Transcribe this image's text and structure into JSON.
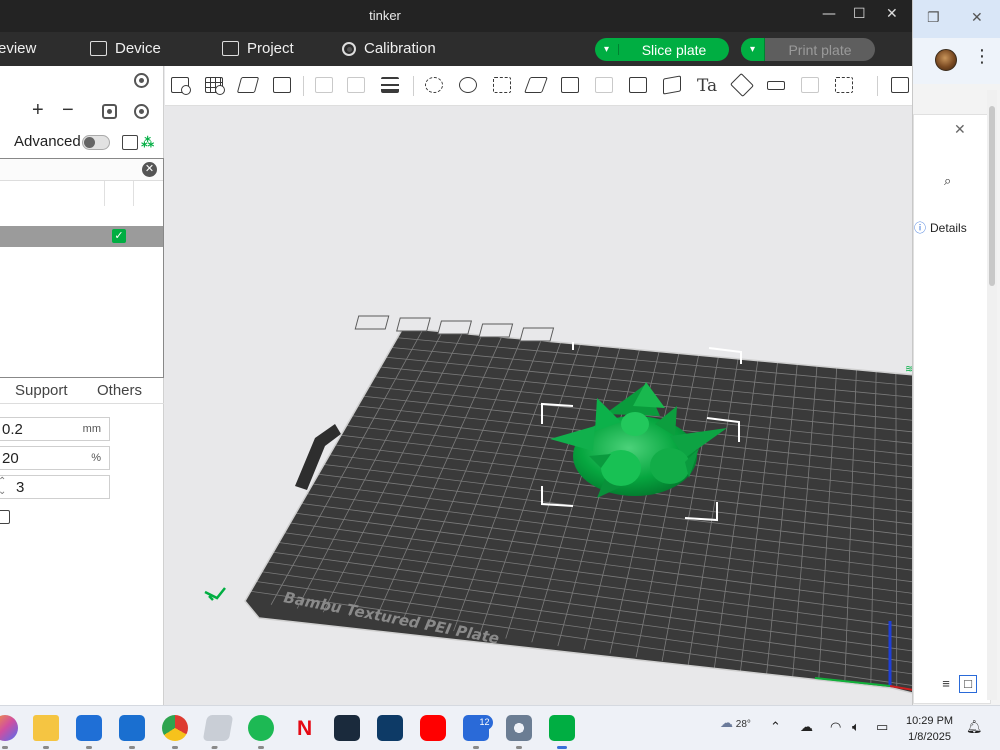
{
  "window": {
    "title": "tinker"
  },
  "window_controls": {
    "minimize": "—",
    "maximize": "☐",
    "close": "✕"
  },
  "menubar": {
    "preview": "eview",
    "device": "Device",
    "project": "Project",
    "calibration": "Calibration",
    "slice": "Slice plate",
    "print": "Print plate"
  },
  "left_panel": {
    "advanced_label": "Advanced",
    "advanced_on": false,
    "tabs": [
      "Support",
      "Others"
    ],
    "fields": [
      {
        "value": "0.2",
        "unit": "mm"
      },
      {
        "value": "20",
        "unit": "%"
      },
      {
        "value": "3",
        "unit": ""
      }
    ]
  },
  "toolbar": {
    "text_tool_glyph": "Ta"
  },
  "viewport": {
    "plate_label": "Bambu Textured PEI Plate",
    "plate_color": "#3a3a3a",
    "model_color": "#00ae42",
    "accent_color": "#00ae42"
  },
  "background_window": {
    "details_label": "Details"
  },
  "taskbar": {
    "badge": "12",
    "weather": "28°",
    "time": "10:29 PM",
    "date": "1/8/2025"
  }
}
